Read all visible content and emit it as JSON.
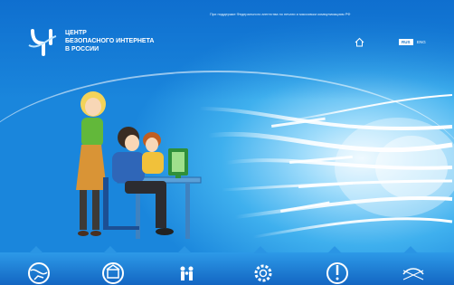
{
  "header": {
    "logo_lines": [
      "ЦЕНТР",
      "БЕЗОПАСНОГО ИНТЕРНЕТА",
      "В РОССИИ"
    ],
    "tagline": "При поддержке Федерального агентства по печати и массовым коммуникациям РФ",
    "lang_active": "RUS",
    "lang_other": "ENG"
  },
  "nav": {
    "tabs": [
      {
        "icon": "globe-icon"
      },
      {
        "icon": "shop-icon"
      },
      {
        "icon": "family-icon"
      },
      {
        "icon": "gear-icon"
      },
      {
        "icon": "warning-icon"
      },
      {
        "icon": "network-icon"
      }
    ]
  },
  "colors": {
    "sky": "#1b8ae0",
    "glow": "#e8f7ff",
    "bar": "#1a7fd6"
  }
}
